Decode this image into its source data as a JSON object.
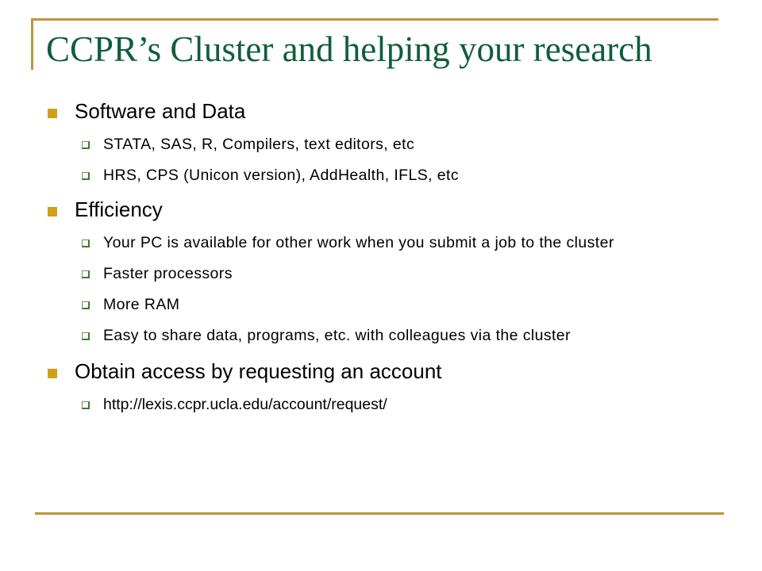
{
  "slide": {
    "title": "CCPR’s Cluster and helping your research",
    "colors": {
      "title": "#0f5e3a",
      "frame": "#b8983a",
      "level1_bullet": "#d0a018",
      "level2_bullet": "#3c7a2c"
    },
    "sections": [
      {
        "heading": "Software and Data",
        "items": [
          "STATA, SAS, R, Compilers, text editors, etc",
          "HRS, CPS (Unicon version), AddHealth, IFLS, etc"
        ]
      },
      {
        "heading": "Efficiency",
        "items": [
          "Your PC is available for other work when you submit a job to the cluster",
          "Faster processors",
          "More RAM",
          "Easy to share data, programs, etc. with colleagues via the cluster"
        ]
      },
      {
        "heading": "Obtain access by requesting an account",
        "items": [
          "http://lexis.ccpr.ucla.edu/account/request/"
        ]
      }
    ]
  }
}
